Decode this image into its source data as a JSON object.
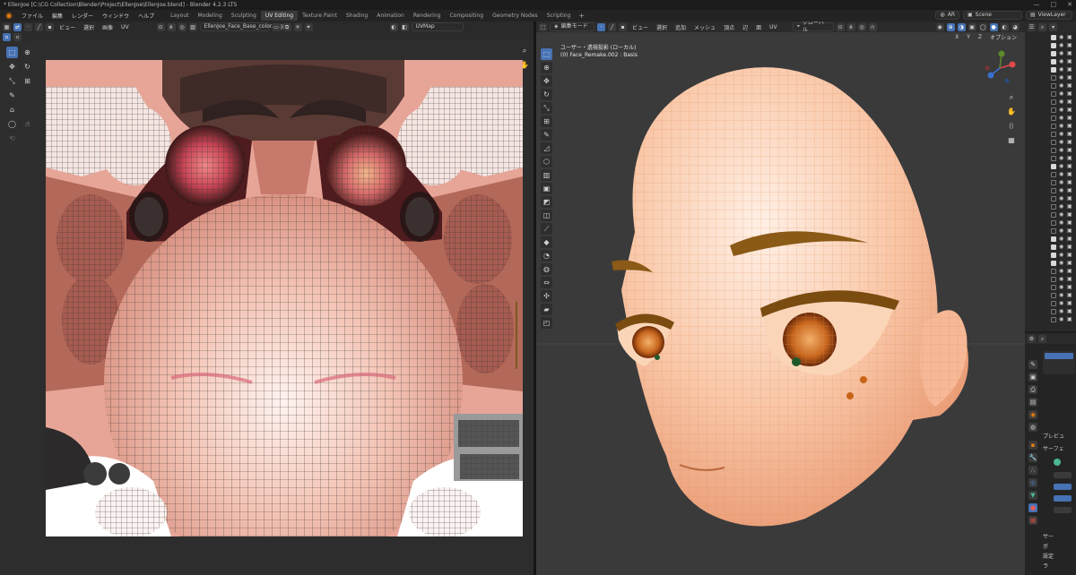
{
  "window": {
    "title": "* EllenJoe [C:\\CG Collection\\Blender\\Project\\EllenJoe\\EllenJoe.blend] - Blender 4.2.3 LTS",
    "controls": [
      "—",
      "□",
      "✕"
    ]
  },
  "topbar": {
    "menus": [
      "ファイル",
      "編集",
      "レンダー",
      "ウィンドウ",
      "ヘルプ"
    ],
    "workspaces": [
      {
        "label": "Layout",
        "active": false
      },
      {
        "label": "Modeling",
        "active": false
      },
      {
        "label": "Sculpting",
        "active": false
      },
      {
        "label": "UV Editing",
        "active": true
      },
      {
        "label": "Texture Paint",
        "active": false
      },
      {
        "label": "Shading",
        "active": false
      },
      {
        "label": "Animation",
        "active": false
      },
      {
        "label": "Rendering",
        "active": false
      },
      {
        "label": "Compositing",
        "active": false
      },
      {
        "label": "Geometry Nodes",
        "active": false
      },
      {
        "label": "Scripting",
        "active": false
      }
    ],
    "add_tab": "+",
    "ar_label": "AR",
    "scene_label": "Scene",
    "view_layer_label": "ViewLayer"
  },
  "uv_editor": {
    "menus": [
      "ビュー",
      "選択",
      "画像",
      "UV"
    ],
    "image_name": "EllenJoe_Face_Base_color.png",
    "uvmap_name": "UVMap"
  },
  "viewport": {
    "mode": "編集モード",
    "menus": [
      "ビュー",
      "選択",
      "追加",
      "メッシュ",
      "頂点",
      "辺",
      "面",
      "UV"
    ],
    "transform_orientation": "グローバル",
    "options_label": "オプション",
    "overlay_line1": "ユーザー・透視投影 (ローカル)",
    "overlay_line2": "(0) Face_Remake.002 : Basis",
    "axes": [
      "X",
      "Y",
      "Z"
    ]
  },
  "properties": {
    "sections": [
      "プレビュ",
      "サーフェ"
    ],
    "bottom_items": [
      "サー",
      "ボ",
      "設定",
      "ラ"
    ]
  },
  "colors": {
    "accent_blue": "#4772b3",
    "blender_orange": "#e87d0d",
    "viewport_bg": "#3a3a3a",
    "skin": "#f5b89a"
  },
  "icons": [
    "blender-logo-icon",
    "cursor-select-icon",
    "move-icon",
    "rotate-icon",
    "scale-icon",
    "transform-icon",
    "annotate-icon",
    "zoom-icon",
    "hand-icon",
    "camera-icon",
    "grid-icon",
    "eye-icon",
    "checkbox-icon"
  ]
}
